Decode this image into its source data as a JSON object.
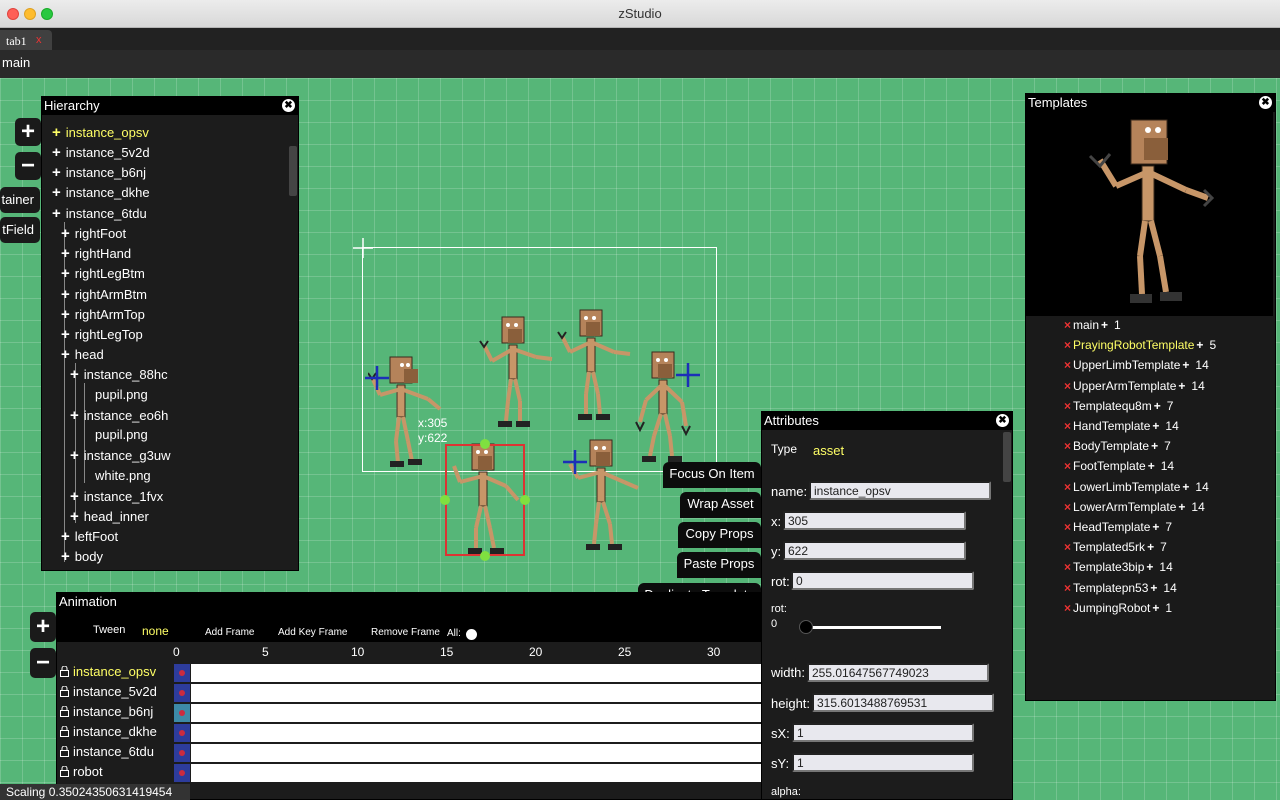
{
  "window": {
    "title": "zStudio"
  },
  "tabs": [
    {
      "label": "tab1",
      "close": "x"
    }
  ],
  "menu": {
    "label": "main"
  },
  "hierarchy": {
    "title": "Hierarchy",
    "items": [
      {
        "label": "instance_opsv"
      },
      {
        "label": "instance_5v2d"
      },
      {
        "label": "instance_b6nj"
      },
      {
        "label": "instance_dkhe"
      },
      {
        "label": "instance_6tdu"
      },
      {
        "label": "rightFoot"
      },
      {
        "label": "rightHand"
      },
      {
        "label": "rightLegBtm"
      },
      {
        "label": "rightArmBtm"
      },
      {
        "label": "rightArmTop"
      },
      {
        "label": "rightLegTop"
      },
      {
        "label": "head"
      },
      {
        "label": "instance_88hc"
      },
      {
        "label": "pupil.png"
      },
      {
        "label": "instance_eo6h"
      },
      {
        "label": "pupil.png"
      },
      {
        "label": "instance_g3uw"
      },
      {
        "label": "white.png"
      },
      {
        "label": "instance_1fvx"
      },
      {
        "label": "head_inner"
      },
      {
        "label": "leftFoot"
      },
      {
        "label": "body"
      }
    ]
  },
  "side_buttons": {
    "add": "+",
    "remove": "−",
    "container": "tainer",
    "textfield": "tField"
  },
  "stage": {
    "coord_x": "x:305",
    "coord_y": "y:622"
  },
  "actions": {
    "focus": "Focus On Item",
    "wrap": "Wrap Asset",
    "copy": "Copy Props",
    "paste": "Paste Props",
    "duplicate": "Duplicate Template"
  },
  "animation": {
    "title": "Animation",
    "tween_label": "Tween",
    "tween_value": "none",
    "add_frame": "Add Frame",
    "add_key_frame": "Add Key Frame",
    "remove_frame": "Remove Frame",
    "all_label": "All:",
    "ruler": [
      "0",
      "5",
      "10",
      "15",
      "20",
      "25",
      "30"
    ],
    "rows": [
      "instance_opsv",
      "instance_5v2d",
      "instance_b6nj",
      "instance_dkhe",
      "instance_6tdu",
      "robot"
    ]
  },
  "scaling": "Scaling 0.35024350631419454",
  "attributes": {
    "title": "Attributes",
    "type_label": "Type",
    "type_value": "asset",
    "name_label": "name:",
    "name_value": "instance_opsv",
    "x_label": "x:",
    "x_value": "305",
    "y_label": "y:",
    "y_value": "622",
    "rot_label": "rot:",
    "rot_value": "0",
    "rot_slider_label": "rot:",
    "rot_slider_value": "0",
    "rot_slider_level": 0,
    "width_label": "width:",
    "width_value": "255.01647567749023",
    "height_label": "height:",
    "height_value": "315.6013488769531",
    "sx_label": "sX:",
    "sx_value": "1",
    "sy_label": "sY:",
    "sy_value": "1",
    "alpha_label": "alpha:"
  },
  "templates": {
    "title": "Templates",
    "items": [
      {
        "name": "main",
        "count": "1",
        "highlight": false
      },
      {
        "name": "PrayingRobotTemplate",
        "count": "5",
        "highlight": true
      },
      {
        "name": "UpperLimbTemplate",
        "count": "14",
        "highlight": false
      },
      {
        "name": "UpperArmTemplate",
        "count": "14",
        "highlight": false
      },
      {
        "name": "Templatequ8m",
        "count": "7",
        "highlight": false
      },
      {
        "name": "HandTemplate",
        "count": "14",
        "highlight": false
      },
      {
        "name": "BodyTemplate",
        "count": "7",
        "highlight": false
      },
      {
        "name": "FootTemplate",
        "count": "14",
        "highlight": false
      },
      {
        "name": "LowerLimbTemplate",
        "count": "14",
        "highlight": false
      },
      {
        "name": "LowerArmTemplate",
        "count": "14",
        "highlight": false
      },
      {
        "name": "HeadTemplate",
        "count": "7",
        "highlight": false
      },
      {
        "name": "Templated5rk",
        "count": "7",
        "highlight": false
      },
      {
        "name": "Template3bip",
        "count": "14",
        "highlight": false
      },
      {
        "name": "Templatepn53",
        "count": "14",
        "highlight": false
      },
      {
        "name": "JumpingRobot",
        "count": "1",
        "highlight": false
      }
    ]
  },
  "colors": {
    "stage": "#56b678",
    "highlight": "#ffff66",
    "selection": "#dd3333",
    "handle": "#7fe040",
    "frame": "#2d3c9c"
  }
}
